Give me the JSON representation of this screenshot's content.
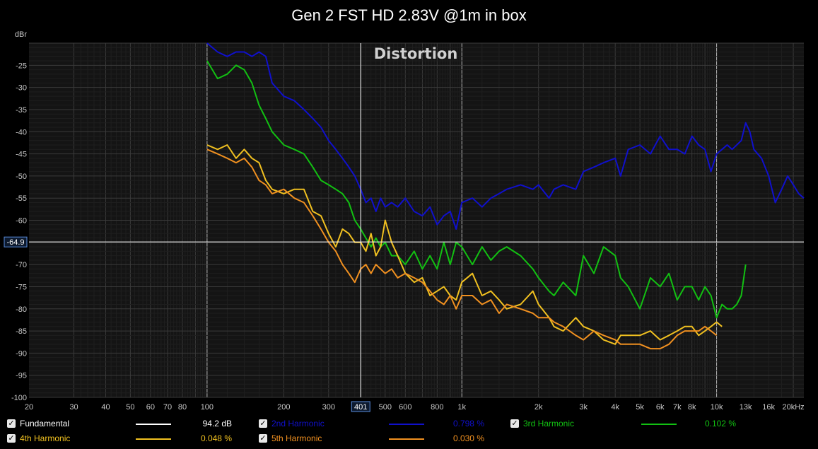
{
  "title": "Gen 2 FST HD 2.83V @1m in box",
  "cursor": {
    "x_label": "401",
    "y_label": "-64.9"
  },
  "chart_data": {
    "type": "line",
    "title": "Gen 2 FST HD 2.83V @1m in box",
    "annotation": "Distortion",
    "ylabel": "dBr",
    "xlabel": "",
    "x_scale": "log",
    "xlim": [
      20,
      22000
    ],
    "ylim": [
      -100,
      -20
    ],
    "grid": true,
    "x_ticks": [
      {
        "value": 20,
        "label": "20"
      },
      {
        "value": 30,
        "label": "30"
      },
      {
        "value": 40,
        "label": "40"
      },
      {
        "value": 50,
        "label": "50"
      },
      {
        "value": 60,
        "label": "60"
      },
      {
        "value": 70,
        "label": "70"
      },
      {
        "value": 80,
        "label": "80"
      },
      {
        "value": 100,
        "label": "100"
      },
      {
        "value": 200,
        "label": "200"
      },
      {
        "value": 300,
        "label": "300"
      },
      {
        "value": 500,
        "label": "500"
      },
      {
        "value": 600,
        "label": "600"
      },
      {
        "value": 800,
        "label": "800"
      },
      {
        "value": 1000,
        "label": "1k"
      },
      {
        "value": 2000,
        "label": "2k"
      },
      {
        "value": 3000,
        "label": "3k"
      },
      {
        "value": 4000,
        "label": "4k"
      },
      {
        "value": 5000,
        "label": "5k"
      },
      {
        "value": 6000,
        "label": "6k"
      },
      {
        "value": 7000,
        "label": "7k"
      },
      {
        "value": 8000,
        "label": "8k"
      },
      {
        "value": 10000,
        "label": "10k"
      },
      {
        "value": 13000,
        "label": "13k"
      },
      {
        "value": 16000,
        "label": "16k"
      },
      {
        "value": 20000,
        "label": "20kHz"
      }
    ],
    "y_ticks": [
      -25,
      -30,
      -35,
      -40,
      -45,
      -50,
      -55,
      -60,
      -70,
      -75,
      -80,
      -85,
      -90,
      -95,
      -100
    ],
    "series": [
      {
        "name": "2nd Harmonic",
        "color": "#1010cc",
        "value_label": "0.798 %",
        "x": [
          100,
          110,
          120,
          130,
          140,
          150,
          160,
          170,
          180,
          200,
          220,
          240,
          260,
          280,
          300,
          320,
          340,
          360,
          380,
          401,
          420,
          440,
          460,
          480,
          500,
          530,
          560,
          600,
          650,
          700,
          750,
          800,
          850,
          900,
          950,
          1000,
          1100,
          1200,
          1300,
          1400,
          1500,
          1700,
          1900,
          2000,
          2200,
          2300,
          2500,
          2800,
          3000,
          3300,
          3600,
          4000,
          4200,
          4500,
          5000,
          5500,
          6000,
          6500,
          7000,
          7500,
          8000,
          8500,
          9000,
          9500,
          10000,
          10500,
          11000,
          11500,
          12000,
          12500,
          13000,
          13500,
          14000,
          15000,
          16000,
          17000,
          18000,
          19000,
          20000,
          21000,
          22000
        ],
        "y": [
          -20,
          -22,
          -23,
          -22,
          -22,
          -23,
          -22,
          -23,
          -29,
          -32,
          -33,
          -35,
          -37,
          -39,
          -42,
          -44,
          -46,
          -48,
          -50,
          -53,
          -56,
          -55,
          -58,
          -55,
          -57,
          -56,
          -57,
          -55,
          -58,
          -59,
          -57,
          -61,
          -59,
          -58,
          -62,
          -56,
          -55,
          -57,
          -55,
          -54,
          -53,
          -52,
          -53,
          -52,
          -55,
          -53,
          -52,
          -53,
          -49,
          -48,
          -47,
          -46,
          -50,
          -44,
          -43,
          -45,
          -41,
          -44,
          -44,
          -45,
          -41,
          -43,
          -44,
          -49,
          -45,
          -44,
          -43,
          -44,
          -43,
          -42,
          -38,
          -40,
          -44,
          -46,
          -50,
          -56,
          -53,
          -50,
          -52,
          -54,
          -55
        ]
      },
      {
        "name": "3rd Harmonic",
        "color": "#12c012",
        "value_label": "0.102 %",
        "x": [
          100,
          110,
          120,
          130,
          140,
          150,
          160,
          170,
          180,
          200,
          220,
          240,
          260,
          280,
          300,
          320,
          340,
          360,
          380,
          401,
          420,
          440,
          460,
          480,
          500,
          530,
          560,
          600,
          650,
          700,
          750,
          800,
          850,
          900,
          950,
          1000,
          1100,
          1200,
          1300,
          1400,
          1500,
          1700,
          1900,
          2000,
          2200,
          2300,
          2500,
          2800,
          3000,
          3300,
          3600,
          4000,
          4200,
          4500,
          5000,
          5500,
          6000,
          6500,
          7000,
          7500,
          8000,
          8500,
          9000,
          9500,
          10000,
          10500,
          11000,
          11500,
          12000,
          12500,
          13000
        ],
        "y": [
          -24,
          -28,
          -27,
          -25,
          -26,
          -29,
          -34,
          -37,
          -40,
          -43,
          -44,
          -45,
          -48,
          -51,
          -52,
          -53,
          -54,
          -56,
          -60,
          -62,
          -64,
          -66,
          -64,
          -66,
          -65,
          -68,
          -68,
          -70,
          -67,
          -71,
          -68,
          -71,
          -65,
          -70,
          -65,
          -66,
          -70,
          -66,
          -69,
          -67,
          -66,
          -68,
          -71,
          -73,
          -76,
          -77,
          -74,
          -77,
          -68,
          -72,
          -66,
          -68,
          -73,
          -75,
          -80,
          -73,
          -75,
          -72,
          -78,
          -75,
          -75,
          -78,
          -75,
          -77,
          -82,
          -79,
          -80,
          -80,
          -79,
          -77,
          -70
        ]
      },
      {
        "name": "4th Harmonic",
        "color": "#f0c020",
        "value_label": "0.048 %",
        "x": [
          100,
          110,
          120,
          130,
          140,
          150,
          160,
          170,
          180,
          200,
          220,
          240,
          260,
          280,
          300,
          320,
          340,
          360,
          380,
          401,
          420,
          440,
          460,
          480,
          500,
          530,
          560,
          600,
          650,
          700,
          750,
          800,
          850,
          900,
          950,
          1000,
          1100,
          1200,
          1300,
          1400,
          1500,
          1700,
          1900,
          2000,
          2200,
          2300,
          2500,
          2800,
          3000,
          3300,
          3600,
          4000,
          4200,
          4500,
          5000,
          5500,
          6000,
          6500,
          7000,
          7500,
          8000,
          8500,
          9000,
          9500,
          10000,
          10500
        ],
        "y": [
          -43,
          -44,
          -43,
          -46,
          -44,
          -46,
          -47,
          -51,
          -53,
          -54,
          -53,
          -53,
          -58,
          -59,
          -63,
          -66,
          -62,
          -63,
          -65,
          -65,
          -67,
          -63,
          -68,
          -66,
          -60,
          -65,
          -68,
          -72,
          -74,
          -73,
          -77,
          -76,
          -75,
          -77,
          -78,
          -74,
          -72,
          -77,
          -76,
          -78,
          -80,
          -79,
          -76,
          -79,
          -82,
          -84,
          -85,
          -82,
          -84,
          -85,
          -87,
          -88,
          -86,
          -86,
          -86,
          -85,
          -87,
          -86,
          -85,
          -84,
          -84,
          -86,
          -85,
          -84,
          -83,
          -84
        ]
      },
      {
        "name": "5th Harmonic",
        "color": "#f09020",
        "value_label": "0.030 %",
        "x": [
          100,
          110,
          120,
          130,
          140,
          150,
          160,
          170,
          180,
          200,
          220,
          240,
          260,
          280,
          300,
          320,
          340,
          360,
          380,
          401,
          420,
          440,
          460,
          480,
          500,
          530,
          560,
          600,
          650,
          700,
          750,
          800,
          850,
          900,
          950,
          1000,
          1100,
          1200,
          1300,
          1400,
          1500,
          1700,
          1900,
          2000,
          2200,
          2300,
          2500,
          2800,
          3000,
          3300,
          3600,
          4000,
          4200,
          4500,
          5000,
          5500,
          6000,
          6500,
          7000,
          7500,
          8000,
          8500,
          9000,
          9500,
          10000
        ],
        "y": [
          -44,
          -45,
          -46,
          -47,
          -46,
          -48,
          -51,
          -52,
          -54,
          -53,
          -55,
          -56,
          -59,
          -62,
          -65,
          -67,
          -70,
          -72,
          -74,
          -71,
          -70,
          -72,
          -70,
          -71,
          -72,
          -71,
          -73,
          -72,
          -73,
          -74,
          -76,
          -78,
          -79,
          -77,
          -80,
          -77,
          -77,
          -79,
          -78,
          -81,
          -79,
          -80,
          -81,
          -82,
          -82,
          -83,
          -84,
          -86,
          -87,
          -85,
          -86,
          -87,
          -88,
          -88,
          -88,
          -89,
          -89,
          -88,
          -86,
          -85,
          -85,
          -85,
          -84,
          -85,
          -86
        ]
      }
    ],
    "fundamental": {
      "name": "Fundamental",
      "color": "#ffffff",
      "value_label": "94.2 dB"
    }
  }
}
